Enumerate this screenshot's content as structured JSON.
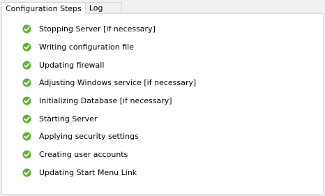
{
  "tabs": [
    {
      "label": "Configuration Steps",
      "active": true
    },
    {
      "label": "Log",
      "active": false
    }
  ],
  "steps": [
    {
      "label": "Stopping Server [if necessary]",
      "status": "done",
      "icon": "check-icon"
    },
    {
      "label": "Writing configuration file",
      "status": "done",
      "icon": "check-icon"
    },
    {
      "label": "Updating firewall",
      "status": "done",
      "icon": "check-icon"
    },
    {
      "label": "Adjusting Windows service [if necessary]",
      "status": "done",
      "icon": "check-icon"
    },
    {
      "label": "Initializing Database [if necessary]",
      "status": "done",
      "icon": "check-icon"
    },
    {
      "label": "Starting Server",
      "status": "done",
      "icon": "check-icon"
    },
    {
      "label": "Applying security settings",
      "status": "done",
      "icon": "check-icon"
    },
    {
      "label": "Creating user accounts",
      "status": "done",
      "icon": "check-icon"
    },
    {
      "label": "Updating Start Menu Link",
      "status": "done",
      "icon": "check-icon"
    }
  ],
  "colors": {
    "check_fill": "#5cb531",
    "check_mark": "#ffffff",
    "tab_border": "#d9d9d9"
  }
}
